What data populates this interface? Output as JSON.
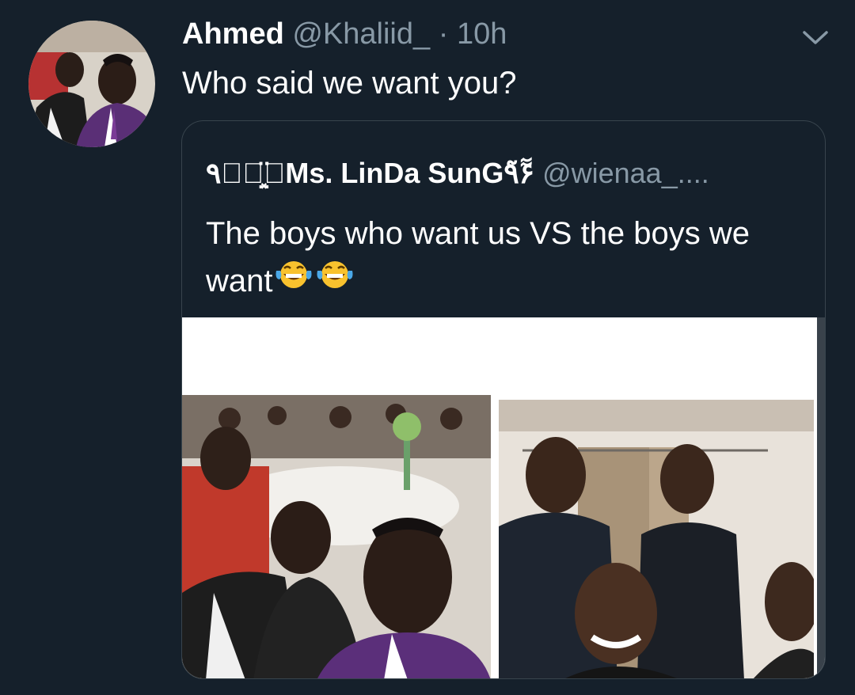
{
  "tweet": {
    "author_name": "Ahmed",
    "author_handle": "@Khaliid_",
    "separator": "·",
    "timestamp": "10h",
    "text": "Who said we want you?",
    "avatar_icon": "profile-photo",
    "menu_icon": "chevron-down-icon"
  },
  "quoted_tweet": {
    "author_name": "٩۶̤͓ۜ̈̈ۜMs. LinDa SunG٩̃ٓٓ̃۶",
    "author_handle": "@wienaa_....",
    "text": "The boys who want us VS the boys we want",
    "emojis": [
      "face-with-tears-of-joy",
      "face-with-tears-of-joy"
    ],
    "media_description_icon": "photo-collage"
  },
  "colors": {
    "background": "#15202b",
    "secondary_text": "#8899a6",
    "border": "#38444d",
    "emoji_yellow": "#f9c22e"
  }
}
